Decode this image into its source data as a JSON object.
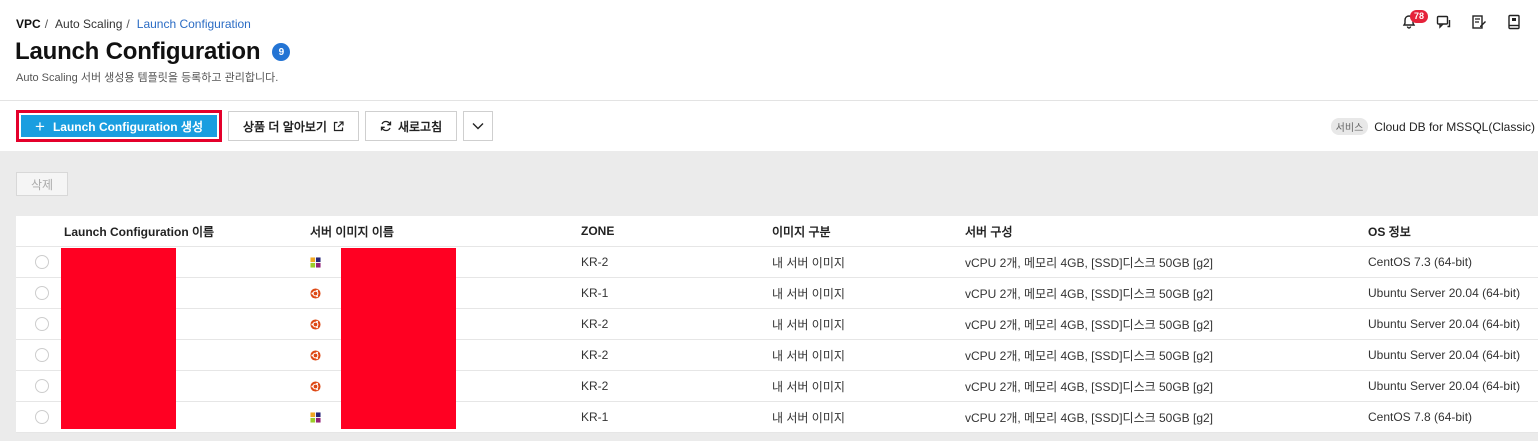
{
  "breadcrumb": {
    "root": "VPC",
    "mid": "Auto Scaling",
    "current": "Launch Configuration",
    "sep": "/"
  },
  "header": {
    "title": "Launch Configuration",
    "count": "9",
    "subtitle": "Auto Scaling 서버 생성용 템플릿을 등록하고 관리합니다.",
    "notification_count": "78"
  },
  "toolbar": {
    "create_label": "Launch Configuration 생성",
    "learn_more_label": "상품 더 알아보기",
    "refresh_label": "새로고침"
  },
  "service": {
    "tag": "서비스",
    "name": "Cloud DB for MSSQL(Classic)"
  },
  "actions": {
    "delete_label": "삭제"
  },
  "table": {
    "columns": [
      "Launch Configuration 이름",
      "서버 이미지 이름",
      "ZONE",
      "이미지 구분",
      "서버 구성",
      "OS 정보"
    ],
    "rows": [
      {
        "os_icon": "centos-icon",
        "zone": "KR-2",
        "image_type": "내 서버 이미지",
        "spec": "vCPU 2개, 메모리 4GB, [SSD]디스크 50GB [g2]",
        "os": "CentOS 7.3 (64-bit)"
      },
      {
        "os_icon": "ubuntu-icon",
        "zone": "KR-1",
        "image_type": "내 서버 이미지",
        "spec": "vCPU 2개, 메모리 4GB, [SSD]디스크 50GB [g2]",
        "os": "Ubuntu Server 20.04 (64-bit)"
      },
      {
        "os_icon": "ubuntu-icon",
        "zone": "KR-2",
        "image_type": "내 서버 이미지",
        "spec": "vCPU 2개, 메모리 4GB, [SSD]디스크 50GB [g2]",
        "os": "Ubuntu Server 20.04 (64-bit)"
      },
      {
        "os_icon": "ubuntu-icon",
        "zone": "KR-2",
        "image_type": "내 서버 이미지",
        "spec": "vCPU 2개, 메모리 4GB, [SSD]디스크 50GB [g2]",
        "os": "Ubuntu Server 20.04 (64-bit)"
      },
      {
        "os_icon": "ubuntu-icon",
        "zone": "KR-2",
        "image_type": "내 서버 이미지",
        "spec": "vCPU 2개, 메모리 4GB, [SSD]디스크 50GB [g2]",
        "os": "Ubuntu Server 20.04 (64-bit)"
      },
      {
        "os_icon": "centos-icon",
        "zone": "KR-1",
        "image_type": "내 서버 이미지",
        "spec": "vCPU 2개, 메모리 4GB, [SSD]디스크 50GB [g2]",
        "os": "CentOS 7.8 (64-bit)"
      }
    ]
  },
  "colors": {
    "accent": "#1a9ee0",
    "highlight_border": "#e4002b",
    "redaction": "#ff0022",
    "badge_blue": "#2374d4",
    "link": "#2b6cc4"
  }
}
